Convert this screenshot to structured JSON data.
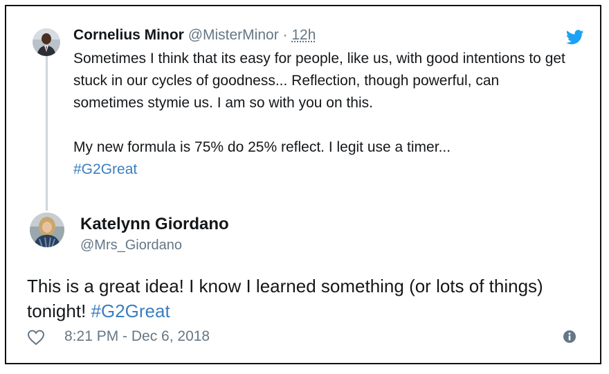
{
  "parent_tweet": {
    "author_name": "Cornelius Minor",
    "author_handle": "@MisterMinor",
    "separator": "·",
    "time": "12h",
    "text_paragraph_1": "Sometimes I think that its easy for people, like us, with good intentions to get stuck in our cycles of goodness... Reflection, though powerful, can sometimes stymie us. I am so with you on this.",
    "text_paragraph_2": "My new formula is 75% do 25% reflect. I legit use a timer...",
    "hashtag": "#G2Great"
  },
  "main_tweet": {
    "author_name": "Katelynn Giordano",
    "author_handle": "@Mrs_Giordano",
    "text": "This is a great idea! I know I learned something (or lots of things) tonight!",
    "hashtag": "#G2Great",
    "timestamp": "8:21 PM - Dec 6, 2018"
  },
  "icons": {
    "brand": "twitter-bird-icon",
    "like": "heart-icon",
    "info": "info-icon"
  },
  "colors": {
    "twitter_blue": "#1da1f2",
    "hashtag_blue": "#3b7ebf",
    "secondary_text": "#657786",
    "thread_line": "#ccd6dd"
  }
}
